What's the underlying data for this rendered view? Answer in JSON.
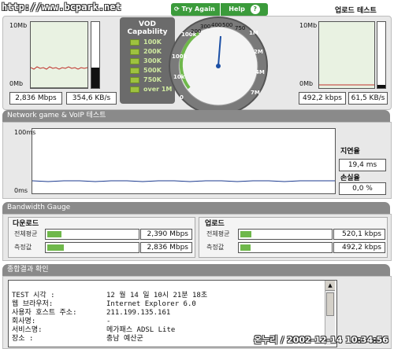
{
  "watermark_url": "http://www.bcpark.net",
  "upload_test_title": "업로드 테스트",
  "download_graph": {
    "top_label": "10Mb",
    "bottom_label": "0Mb",
    "speed_mbps": "2,836 Mbps",
    "speed_kbs": "354,6 KB/s"
  },
  "upload_graph": {
    "top_label": "10Mb",
    "bottom_label": "0Mb",
    "speed_kbps": "492,2 kbps",
    "speed_kbs": "61,5 KB/s"
  },
  "vod": {
    "title_line1": "VOD",
    "title_line2": "Capability",
    "levels": [
      "100K",
      "200K",
      "300K",
      "500K",
      "750K",
      "over 1M"
    ]
  },
  "gauge": {
    "try_again": "Try Again",
    "help": "Help",
    "help_icon": "?",
    "ticks": [
      "100k",
      "200",
      "300",
      "400",
      "500",
      "750",
      "1M",
      "2M",
      "4M",
      "7M",
      "10",
      "8M",
      "0",
      "10k",
      "100k"
    ],
    "needle_value": "500"
  },
  "network_game": {
    "title": "Network game & VoIP 테스트",
    "top_label": "100ms",
    "bottom_label": "0ms",
    "latency_title": "지연율",
    "latency_value": "19,4 ms",
    "loss_title": "손실율",
    "loss_value": "0,0 %"
  },
  "bandwidth": {
    "title": "Bandwidth Gauge",
    "download": {
      "title": "다운로드",
      "avg_label": "전체평균",
      "avg_value": "2,390 Mbps",
      "avg_fill": 0.15,
      "meas_label": "측정값",
      "meas_value": "2,836 Mbps",
      "meas_fill": 0.18
    },
    "upload": {
      "title": "업로드",
      "avg_label": "전체평균",
      "avg_value": "520,1 kbps",
      "avg_fill": 0.12,
      "meas_label": "측정값",
      "meas_value": "492,2 kbps",
      "meas_fill": 0.11
    }
  },
  "summary": {
    "title": "종합결과 확인",
    "rows": [
      {
        "label": "TEST 시각 :",
        "value": "12 월 14 일   10시 21분 18초"
      },
      {
        "label": "웹 브라우저:",
        "value": "Internet Explorer 6.0"
      },
      {
        "label": "사용자 호스트 주소:",
        "value": "211.199.135.161"
      },
      {
        "label": "회사명:",
        "value": "-"
      },
      {
        "label": "서비스명:",
        "value": "메가패스 ADSL Lite"
      },
      {
        "label": "장소 :",
        "value": "충남 예산군"
      }
    ]
  },
  "signature": "온누리 / 2002-12-14 10:34:56"
}
